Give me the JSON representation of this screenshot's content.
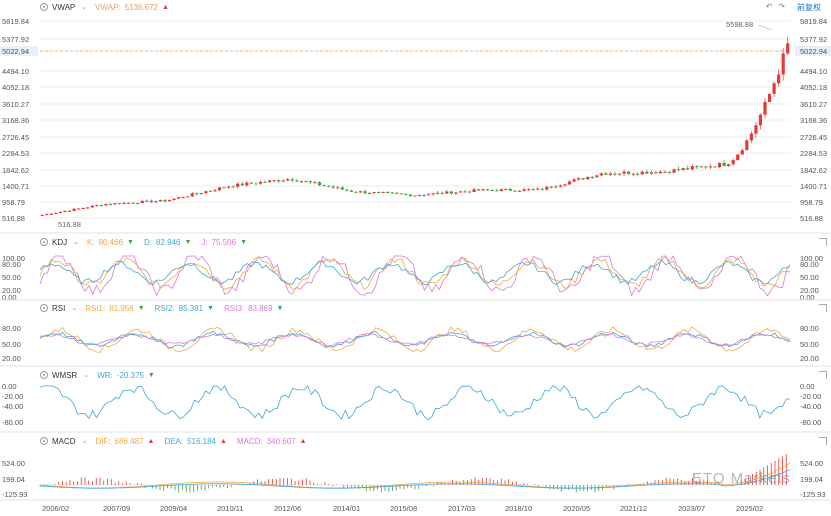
{
  "main": {
    "indicator": "VWAP",
    "vwap_label": "VWAP:",
    "vwap_value": "5136.672",
    "fuquan": "前复权",
    "y_ticks": [
      "5819.84",
      "5377.92",
      "5022.94",
      "4494.10",
      "4052.18",
      "3610.27",
      "3168.36",
      "2726.45",
      "2284.53",
      "1842.62",
      "1400.71",
      "958.79",
      "516.88"
    ],
    "last_price": "5022.94",
    "high_label": "5598.88",
    "low_label": "516.88"
  },
  "kdj": {
    "name": "KDJ",
    "k_label": "K:",
    "k_value": "80.466",
    "d_label": "D:",
    "d_value": "82.946",
    "j_label": "J:",
    "j_value": "75.506",
    "y_ticks": [
      "100.00",
      "80.00",
      "50.00",
      "20.00",
      "0.00"
    ]
  },
  "rsi": {
    "name": "RSI",
    "r1_label": "RSI1:",
    "r1_value": "81.956",
    "r2_label": "RSI2:",
    "r2_value": "85.381",
    "r3_label": "RSI3:",
    "r3_value": "83.869",
    "y_ticks": [
      "80.00",
      "50.00",
      "20.00"
    ]
  },
  "wmsr": {
    "name": "WMSR",
    "wr_label": "WR:",
    "wr_value": "-20.375",
    "y_ticks": [
      "0.00",
      "-20.00",
      "-40.00",
      "-80.00"
    ]
  },
  "macd": {
    "name": "MACD",
    "dif_label": "DIF:",
    "dif_value": "686.487",
    "dea_label": "DEA:",
    "dea_value": "516.184",
    "macd_label": "MACD:",
    "macd_value": "340.607",
    "y_ticks": [
      "524.00",
      "199.04",
      "-125.93"
    ]
  },
  "x_ticks": [
    "2006/02",
    "2007/09",
    "2009/04",
    "2010/11",
    "2012/06",
    "2014/01",
    "2015/08",
    "2017/03",
    "2018/10",
    "2020/05",
    "2021/12",
    "2023/07",
    "2025/02"
  ],
  "watermark": "ETO Markets",
  "colors": {
    "up": "#e53935",
    "down": "#43a047",
    "k": "#f5a742",
    "d": "#3fa9d6",
    "j": "#d77ad8",
    "price_line": "#f0a060"
  },
  "chart_data": [
    {
      "type": "candlestick",
      "title": "VWAP",
      "x": [
        "2006/02",
        "2007/09",
        "2009/04",
        "2010/11",
        "2012/06",
        "2014/01",
        "2015/08",
        "2017/03",
        "2018/10",
        "2020/05",
        "2021/12",
        "2023/07",
        "2025/02"
      ],
      "close_approx": [
        600,
        900,
        1000,
        1400,
        1600,
        1250,
        1150,
        1280,
        1300,
        1750,
        1800,
        2000,
        4500
      ],
      "high": 5598.88,
      "low": 516.88,
      "last": 5022.94,
      "ylim": [
        516.88,
        5819.84
      ],
      "grid": true
    },
    {
      "type": "line",
      "title": "KDJ",
      "series": [
        {
          "name": "K",
          "last": 80.466
        },
        {
          "name": "D",
          "last": 82.946
        },
        {
          "name": "J",
          "last": 75.506
        }
      ],
      "ylim": [
        0,
        100
      ]
    },
    {
      "type": "line",
      "title": "RSI",
      "series": [
        {
          "name": "RSI1",
          "last": 81.956
        },
        {
          "name": "RSI2",
          "last": 85.381
        },
        {
          "name": "RSI3",
          "last": 83.869
        }
      ],
      "ylim": [
        20,
        80
      ]
    },
    {
      "type": "line",
      "title": "WMSR",
      "series": [
        {
          "name": "WR",
          "last": -20.375
        }
      ],
      "ylim": [
        -80,
        0
      ]
    },
    {
      "type": "bar",
      "title": "MACD",
      "series": [
        {
          "name": "DIF",
          "last": 686.487
        },
        {
          "name": "DEA",
          "last": 516.184
        },
        {
          "name": "MACD",
          "last": 340.607
        }
      ],
      "ylim": [
        -125.93,
        524.0
      ]
    }
  ]
}
